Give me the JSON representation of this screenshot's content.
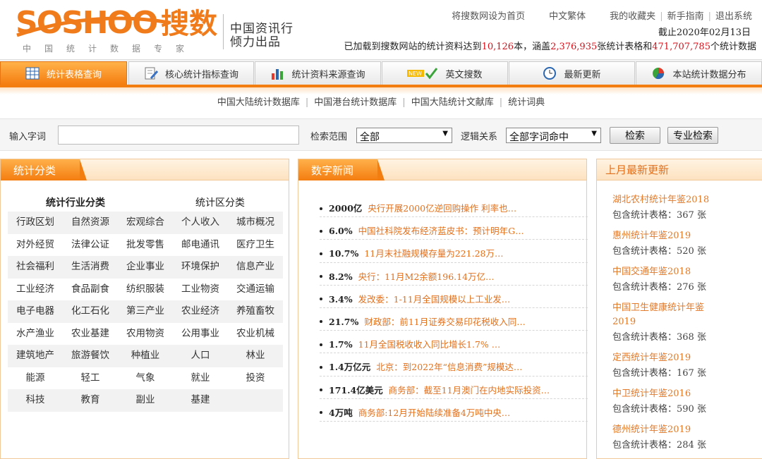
{
  "logo": {
    "brand_latin": "SOSHOO",
    "brand_cn": "搜数",
    "slogan": "中国统计数据专家",
    "company": "中国资讯行\n倾力出品"
  },
  "top_links": [
    "将搜数网设为首页",
    "中文繁体",
    "我的收藏夹",
    "新手指南",
    "退出系统"
  ],
  "as_of": "截止2020年02月13日",
  "stats_summary": {
    "prefix": "已加载到搜数网站的统计资料达到",
    "books": "10,126",
    "mid1": "本，涵盖",
    "tables": "2,376,935",
    "mid2": "张统计表格和",
    "stats": "471,707,785",
    "suffix": "个统计数据"
  },
  "nav_tabs": [
    {
      "label": "统计表格查询",
      "icon": "table-icon",
      "active": true
    },
    {
      "label": "核心统计指标查询",
      "icon": "document-pen-icon",
      "active": false
    },
    {
      "label": "统计资料来源查询",
      "icon": "bar-chart-icon",
      "active": false
    },
    {
      "label": "英文搜数",
      "icon": "new-check-icon",
      "active": false
    },
    {
      "label": "最新更新",
      "icon": "clock-icon",
      "active": false
    },
    {
      "label": "本站统计数据分布",
      "icon": "pie-chart-icon",
      "active": false
    }
  ],
  "sublinks": [
    "中国大陆统计数据库",
    "中国港台统计数据库",
    "中国大陆统计文献库",
    "统计词典"
  ],
  "search": {
    "keyword_label": "输入字词",
    "keyword_value": "",
    "scope_label": "检索范围",
    "scope_value": "全部",
    "logic_label": "逻辑关系",
    "logic_value": "全部字词命中",
    "search_button": "检索",
    "advanced_button": "专业检索"
  },
  "categories": {
    "title": "统计分类",
    "header_industry": "统计行业分类",
    "header_region": "统计区分类",
    "rows": [
      [
        "行政区划",
        "自然资源",
        "宏观综合",
        "个人收入",
        "城市概况"
      ],
      [
        "对外经贸",
        "法律公证",
        "批发零售",
        "邮电通讯",
        "医疗卫生"
      ],
      [
        "社会福利",
        "生活消费",
        "企业事业",
        "环境保护",
        "信息产业"
      ],
      [
        "工业经济",
        "食品副食",
        "纺织服装",
        "工业物资",
        "交通运输"
      ],
      [
        "电子电器",
        "化工石化",
        "第三产业",
        "农业经济",
        "养殖畜牧"
      ],
      [
        "水产渔业",
        "农业基建",
        "农用物资",
        "公用事业",
        "农业机械"
      ],
      [
        "建筑地产",
        "旅游餐饮",
        "种植业",
        "人口",
        "林业"
      ],
      [
        "能源",
        "轻工",
        "气象",
        "就业",
        "投资"
      ],
      [
        "科技",
        "教育",
        "副业",
        "基建",
        ""
      ]
    ]
  },
  "news": {
    "title": "数字新闻",
    "items": [
      {
        "value": "2000亿",
        "text": "央行开展2000亿逆回购操作 利率也…"
      },
      {
        "value": "6.0%",
        "text": "中国社科院发布经济蓝皮书：预计明年G…"
      },
      {
        "value": "10.7%",
        "text": "11月末社融规模存量为221.28万…"
      },
      {
        "value": "8.2%",
        "text": "央行：11月M2余额196.14万亿…"
      },
      {
        "value": "3.4%",
        "text": "发改委：1-11月全国规模以上工业发…"
      },
      {
        "value": "21.7%",
        "text": "财政部：前11月证券交易印花税收入同…"
      },
      {
        "value": "1.7%",
        "text": "11月全国税收收入同比增长1.7% …"
      },
      {
        "value": "1.4万亿元",
        "text": "北京：到2022年“信息消费”规模达…"
      },
      {
        "value": "171.4亿美元",
        "text": "商务部：截至11月澳门在内地实际投资…"
      },
      {
        "value": "4万吨",
        "text": "商务部:12月开始陆续准备4万吨中央…"
      }
    ]
  },
  "updates": {
    "title": "上月最新更新",
    "items": [
      {
        "title": "湖北农村统计年鉴2018",
        "count": "包含统计表格：367 张"
      },
      {
        "title": "惠州统计年鉴2019",
        "count": "包含统计表格：520 张"
      },
      {
        "title": "中国交通年鉴2018",
        "count": "包含统计表格：276 张"
      },
      {
        "title": "中国卫生健康统计年鉴2019",
        "count": "包含统计表格：368 张"
      },
      {
        "title": "定西统计年鉴2019",
        "count": "包含统计表格：167 张"
      },
      {
        "title": "中卫统计年鉴2016",
        "count": "包含统计表格：590 张"
      },
      {
        "title": "德州统计年鉴2019",
        "count": "包含统计表格：284 张"
      }
    ]
  },
  "colors": {
    "accent": "#f47d10",
    "link_orange": "#e2701c",
    "number_red": "#d4111b"
  }
}
